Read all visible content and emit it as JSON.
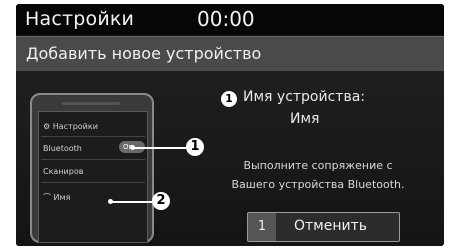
{
  "statusbar": {
    "title": "Настройки",
    "time": "00:00"
  },
  "header": {
    "title": "Добавить новое устройство"
  },
  "phone": {
    "settings_label": "Настройки",
    "bluetooth_label": "Bluetooth",
    "toggle_label": "On",
    "scan_label": "Сканиров",
    "device_label": "Имя",
    "callout_1": "1",
    "callout_2": "2"
  },
  "info": {
    "index": "1",
    "device_name_label": "Имя устройства:",
    "device_name_value": "Имя",
    "instruction_line1": "Выполните сопряжение с",
    "instruction_line2": "Вашего устройства Bluetooth."
  },
  "cancel_button": {
    "index": "1",
    "label": "Отменить"
  }
}
